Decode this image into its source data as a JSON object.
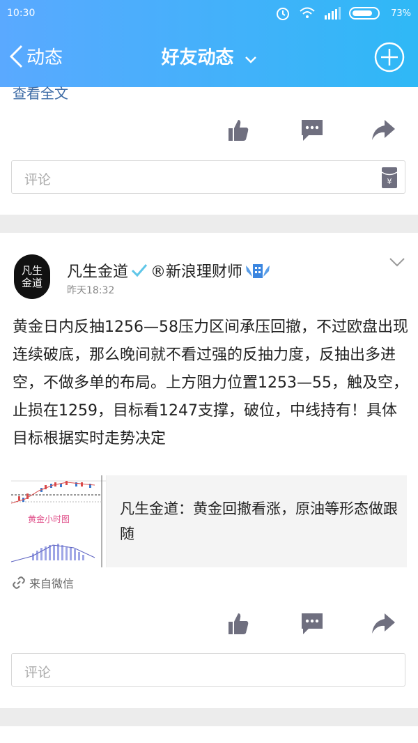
{
  "status_bar": {
    "time": "10:30",
    "battery": "73%"
  },
  "nav": {
    "back_label": "动态",
    "title": "好友动态"
  },
  "post1": {
    "read_more": "查看全文",
    "comment_placeholder": "评论"
  },
  "post2": {
    "author": "凡生金道",
    "badge_text": "®新浪理财师",
    "time": "昨天18:32",
    "avatar_text": "凡生金道",
    "body": "黄金日内反抽1256—58压力区间承压回撤，不过欧盘出现连续破底，那么晚间就不看过强的反抽力度，反抽出多进空，不做多单的布局。上方阻力位置1253—55，触及空，止损在1259，目标看1247支撑，破位，中线持有！具体目标根据实时走势决定",
    "share_card": {
      "thumb_caption": "黄金小时图",
      "title": "凡生金道：黄金回撤看涨，原油等形态做跟随"
    },
    "source": "来自微信",
    "comment_placeholder": "评论"
  },
  "colors": {
    "header_start": "#5aa9ff",
    "header_end": "#2fb8f6",
    "icon": "#6f6f7f",
    "link": "#3b6aa5"
  }
}
